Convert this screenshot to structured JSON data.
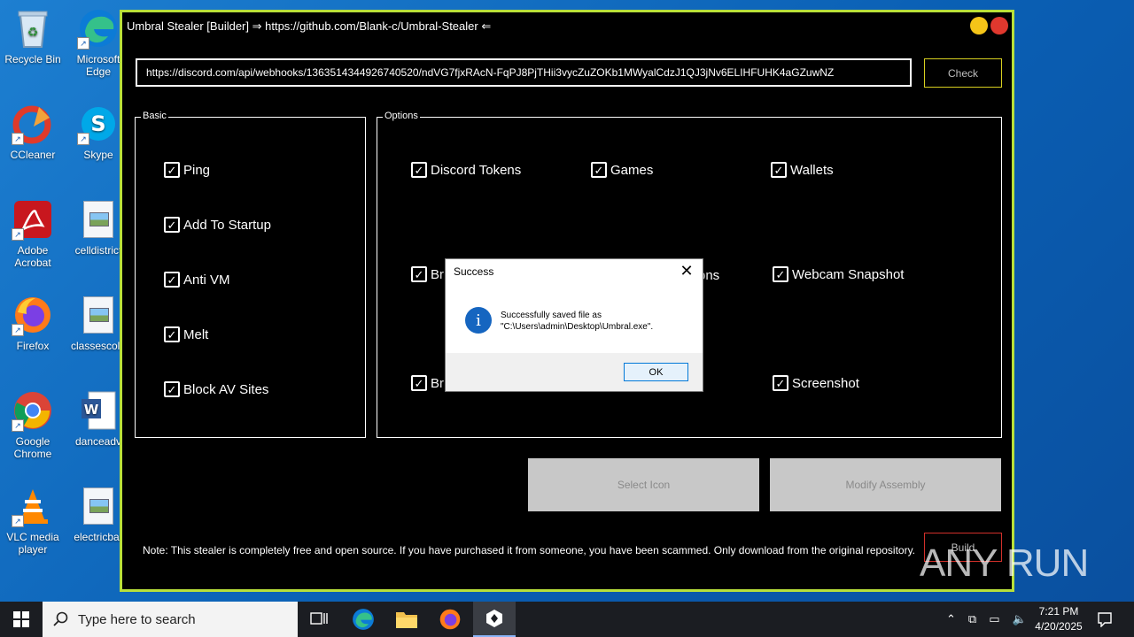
{
  "desktop": {
    "icons": [
      {
        "label": "Recycle Bin"
      },
      {
        "label": "Microsoft Edge"
      },
      {
        "label": "CCleaner"
      },
      {
        "label": "Skype"
      },
      {
        "label": "Adobe Acrobat"
      },
      {
        "label": "celldistrict"
      },
      {
        "label": "Firefox"
      },
      {
        "label": "classescolo"
      },
      {
        "label": "Google Chrome"
      },
      {
        "label": "danceadv"
      },
      {
        "label": "VLC media player"
      },
      {
        "label": "electricbar"
      }
    ]
  },
  "window": {
    "title": "Umbral Stealer [Builder] ⇒ https://github.com/Blank-c/Umbral-Stealer ⇐",
    "webhook_value": "https://discord.com/api/webhooks/1363514344926740520/ndVG7fjxRAcN-FqPJ8PjTHii3vycZuZOKb1MWyalCdzJ1QJ3jNv6ELIHFUHK4aGZuwNZ",
    "check_label": "Check",
    "basic_label": "Basic",
    "options_label": "Options",
    "basic_options": [
      {
        "label": "Ping"
      },
      {
        "label": "Add To Startup"
      },
      {
        "label": "Anti VM"
      },
      {
        "label": "Melt"
      },
      {
        "label": "Block AV Sites"
      }
    ],
    "options": [
      {
        "label": "Discord Tokens"
      },
      {
        "label": "Games"
      },
      {
        "label": "Wallets"
      },
      {
        "label": "Br"
      },
      {
        "label": "ons"
      },
      {
        "label": "Webcam Snapshot"
      },
      {
        "label": "Br"
      },
      {
        "label": "Screenshot"
      }
    ],
    "select_icon_label": "Select Icon",
    "modify_assembly_label": "Modify Assembly",
    "note": "Note: This stealer is completely free and open source. If you have purchased it from someone, you have been scammed. Only download from the original repository.",
    "build_label": "Build"
  },
  "dialog": {
    "title": "Success",
    "message_line1": "Successfully saved file as",
    "message_line2": "\"C:\\Users\\admin\\Desktop\\Umbral.exe\".",
    "ok_label": "OK"
  },
  "watermark": {
    "text": "ANY RUN"
  },
  "taskbar": {
    "search_placeholder": "Type here to search",
    "time": "7:21 PM",
    "date": "4/20/2025"
  },
  "colors": {
    "window_border": "#b8e03a",
    "check_border": "#d8d020",
    "build_border": "#d2302a",
    "desktop_bg": "#0a5fb4",
    "taskbar_bg": "#1b1d22"
  }
}
